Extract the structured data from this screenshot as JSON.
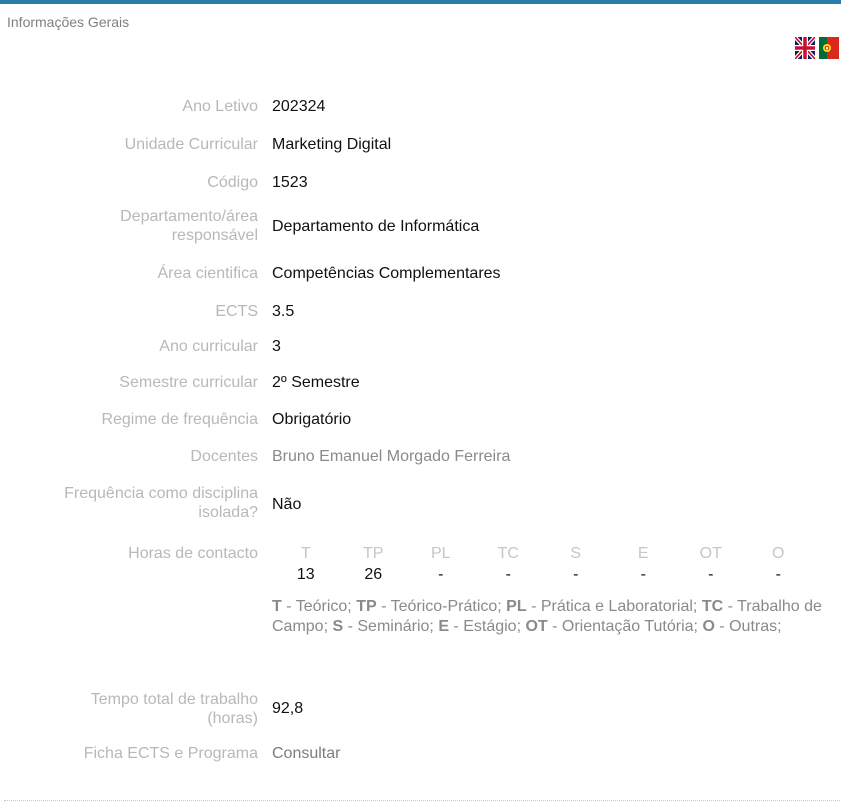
{
  "header": {
    "section_title": "Informações Gerais"
  },
  "languages": [
    {
      "name": "english-flag-icon",
      "label": "English"
    },
    {
      "name": "portugal-flag-icon",
      "label": "Português"
    }
  ],
  "fields": {
    "ano_letivo": {
      "label": "Ano Letivo",
      "value": "202324"
    },
    "unidade_curricular": {
      "label": "Unidade Curricular",
      "value": "Marketing Digital"
    },
    "codigo": {
      "label": "Código",
      "value": "1523"
    },
    "departamento": {
      "label_line1": "Departamento/área",
      "label_line2": "responsável",
      "value": "Departamento de Informática"
    },
    "area_cientifica": {
      "label": "Área cientifica",
      "value": "Competências Complementares"
    },
    "ects": {
      "label": "ECTS",
      "value": "3.5"
    },
    "ano_curricular": {
      "label": "Ano curricular",
      "value": "3"
    },
    "semestre_curricular": {
      "label": "Semestre curricular",
      "value": "2º Semestre"
    },
    "regime_frequencia": {
      "label": "Regime de frequência",
      "value": "Obrigatório"
    },
    "docentes": {
      "label": "Docentes",
      "value": "Bruno Emanuel Morgado Ferreira"
    },
    "frequencia_isolada": {
      "label_line1": "Frequência como disciplina",
      "label_line2": "isolada?",
      "value": "Não"
    },
    "horas_contacto": {
      "label": "Horas de contacto"
    },
    "tempo_total": {
      "label_line1": "Tempo total de trabalho",
      "label_line2": "(horas)",
      "value": "92,8"
    },
    "ficha_ects": {
      "label": "Ficha ECTS e Programa",
      "value": "Consultar"
    }
  },
  "hours": {
    "headers": [
      "T",
      "TP",
      "PL",
      "TC",
      "S",
      "E",
      "OT",
      "O"
    ],
    "values": [
      "13",
      "26",
      "-",
      "-",
      "-",
      "-",
      "-",
      "-"
    ]
  },
  "legend": [
    {
      "abbr": "T",
      "desc": " - Teórico;"
    },
    {
      "abbr": "TP",
      "desc": " - Teórico-Prático;"
    },
    {
      "abbr": "PL",
      "desc": " - Prática e Laboratorial;"
    },
    {
      "abbr": "TC",
      "desc": " - Trabalho de Campo;"
    },
    {
      "abbr": "S",
      "desc": " - Seminário;"
    },
    {
      "abbr": "E",
      "desc": " - Estágio;"
    },
    {
      "abbr": "OT",
      "desc": " - Orientação Tutória;"
    },
    {
      "abbr": "O",
      "desc": " - Outras;"
    }
  ],
  "colors": {
    "accent_bar": "#2a7fa8",
    "label_gray": "#b8b8b8",
    "value_dark": "#111111"
  }
}
